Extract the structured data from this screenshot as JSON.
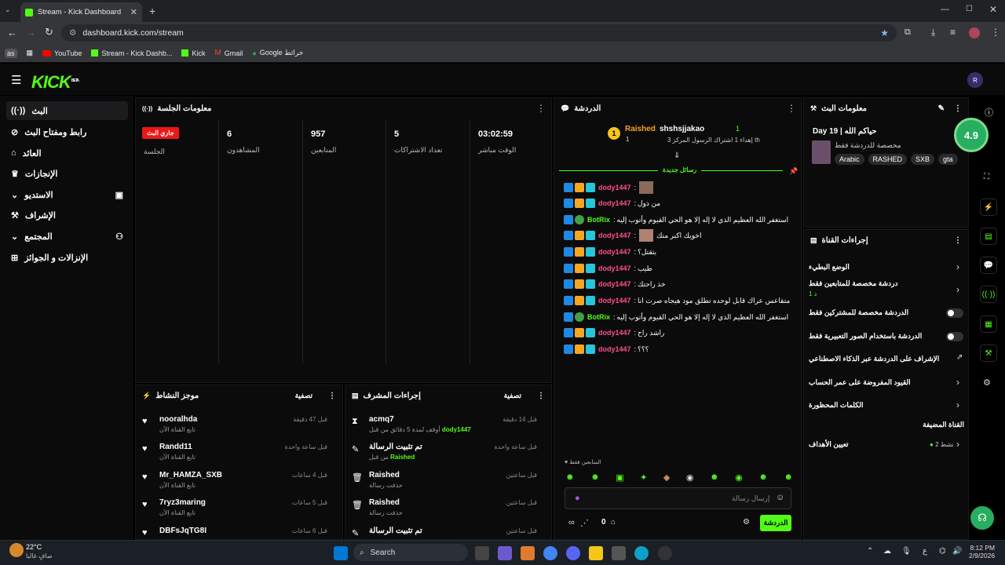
{
  "browser": {
    "tab_title": "Stream - Kick Dashboard",
    "url": "dashboard.kick.com/stream",
    "bookmarks": [
      "YouTube",
      "Stream - Kick Dashb...",
      "Kick",
      "Gmail",
      "Google خرائط"
    ],
    "profile_label": "as"
  },
  "header": {
    "logo": "KICK",
    "beta": "BETA"
  },
  "sidebar": {
    "items": [
      {
        "label": "البث",
        "icon": "broadcast-icon"
      },
      {
        "label": "رابط ومفتاح البث",
        "icon": "link-icon"
      },
      {
        "label": "العائد",
        "icon": "bank-icon"
      },
      {
        "label": "الإنجازات",
        "icon": "trophy-icon"
      },
      {
        "label": "الاستديو",
        "icon": "studio-icon"
      },
      {
        "label": "الإشراف",
        "icon": "wrench-icon"
      },
      {
        "label": "المجتمع",
        "icon": "people-icon"
      },
      {
        "label": "الإنزالات و الجوائز",
        "icon": "gift-icon"
      }
    ]
  },
  "session": {
    "title": "معلومات الجلسة",
    "live_badge": "جاري البث",
    "live_label": "الجلسة",
    "stats": [
      {
        "value": "6",
        "label": "المشاهدون"
      },
      {
        "value": "957",
        "label": "المتابعين"
      },
      {
        "value": "5",
        "label": "تعداد الاشتراكات"
      },
      {
        "value": "03:02:59",
        "label": "الوقت مباشر"
      }
    ]
  },
  "chat": {
    "title": "الدردشة",
    "top_gifter": {
      "name": "Raished",
      "count": "1",
      "rank": "1"
    },
    "pinned_user": {
      "name": "shshsjjakao",
      "count": "1",
      "sub": "إهداء 1 اشتراك الرسول المركز 3 th"
    },
    "new_messages": "رسائل جديدة",
    "messages": [
      {
        "user": "dody1447",
        "text": ""
      },
      {
        "user": "dody1447",
        "text": "من ذول"
      },
      {
        "user": "BotRix",
        "text": "استغفر الله العظيم الذي لا إله إلا هو الحي القيوم وأتوب إليه",
        "bot": true
      },
      {
        "user": "dody1447",
        "text": "اخويك اكبر منك"
      },
      {
        "user": "dody1447",
        "text": "بتقتل؟"
      },
      {
        "user": "dody1447",
        "text": "طيب"
      },
      {
        "user": "dody1447",
        "text": "خذ راحتك"
      },
      {
        "user": "dody1447",
        "text": "متقاعس عراك قابل لوحده تطلق مود هيجاه صرت انا"
      },
      {
        "user": "BotRix",
        "text": "استغفر الله العظيم الذي لا إله إلا هو الحي القيوم وأتوب إليه",
        "bot": true
      },
      {
        "user": "dody1447",
        "text": "راشد راح"
      },
      {
        "user": "dody1447",
        "text": "؟؟؟"
      }
    ],
    "followers_only": "المتابعين فقط",
    "input_placeholder": "إرسال رسالة",
    "send_label": "الدردشة",
    "viewer_count": "0"
  },
  "activity": {
    "title": "موجز النشاط",
    "filter": "تصفية",
    "rows": [
      {
        "name": "nooralhda",
        "sub": "تابع القناة الآن",
        "time": "قبل 47 دقيقة"
      },
      {
        "name": "Randd11",
        "sub": "تابع القناة الآن",
        "time": "قبل ساعة واحدة"
      },
      {
        "name": "Mr_HAMZA_SXB",
        "sub": "تابع القناة الآن",
        "time": "قبل 4 ساعات"
      },
      {
        "name": "7ryz3maring",
        "sub": "تابع القناة الآن",
        "time": "قبل 5 ساعات"
      },
      {
        "name": "DBFsJqTG8I",
        "sub": "",
        "time": "قبل 6 ساعات"
      }
    ]
  },
  "modactions": {
    "title": "إجراءات المشرف",
    "filter": "تصفية",
    "rows": [
      {
        "name": "acmq7",
        "sub": "أوقف لمدة 5 دقائق من قبل",
        "by": "dody1447",
        "time": "قبل 14 دقيقة",
        "icon": "hourglass-icon"
      },
      {
        "name": "تم تثبيت الرسالة",
        "sub": "من قبل",
        "by": "Raished",
        "time": "قبل ساعة واحدة",
        "icon": "pin-icon"
      },
      {
        "name": "Raished",
        "sub": "حذفت رسالة",
        "by": "",
        "time": "قبل ساعتين",
        "icon": "trash-icon"
      },
      {
        "name": "Raished",
        "sub": "حذفت رسالة",
        "by": "",
        "time": "قبل ساعتين",
        "icon": "trash-icon"
      },
      {
        "name": "تم تثبيت الرسالة",
        "sub": "",
        "by": "",
        "time": "قبل ساعتين",
        "icon": "pin-icon"
      }
    ]
  },
  "streaminfo": {
    "title": "معلومات البث",
    "stream_title": "Day 19 | حياكم الله",
    "category": "مخصصة للدردشة فقط",
    "tags": [
      "Arabic",
      "RASHED",
      "SXB",
      "gta"
    ],
    "rating": "4.9"
  },
  "channel_actions": {
    "title": "إجراءات القناة",
    "rows": [
      {
        "label": "الوضع البطيء",
        "type": "chevron"
      },
      {
        "label": "دردشة مخصصة للمتابعين فقط",
        "sub": "1 د",
        "type": "chevron"
      },
      {
        "label": "الدردشة مخصصة للمشتركين فقط",
        "type": "toggle"
      },
      {
        "label": "الدردشة باستخدام الصور التعبيرية فقط",
        "type": "toggle"
      },
      {
        "label": "الإشراف على الدردشة عبر الذكاء الاصطناعي",
        "type": "external"
      },
      {
        "label": "القيود المفروضة على عمر الحساب",
        "type": "chevron"
      },
      {
        "label": "الكلمات المحظورة",
        "type": "chevron"
      },
      {
        "label": "القناة المضيفة",
        "type": "none"
      },
      {
        "label": "تعيين الأهداف",
        "sub": "نشط 2",
        "type": "chevron"
      }
    ]
  },
  "taskbar": {
    "weather_temp": "22°C",
    "weather_desc": "صافٍ غالبا",
    "search": "Search",
    "time": "8:12 PM",
    "date": "2/9/2026",
    "lang": "ع"
  },
  "colors": {
    "accent": "#53fc18",
    "live": "#e91916",
    "username": "#ff4f8b"
  }
}
